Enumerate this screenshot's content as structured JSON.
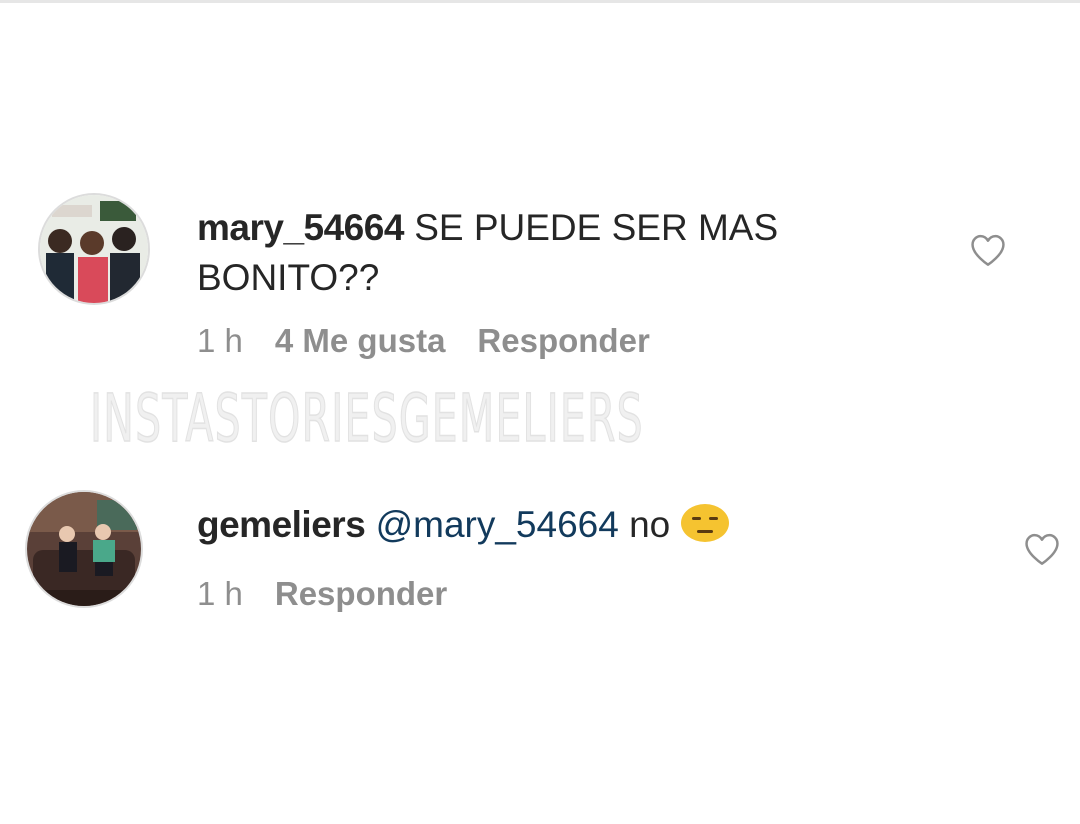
{
  "watermark": "INSTASTORIESGEMELIERS",
  "comments": [
    {
      "username": "mary_54664",
      "text": "SE PUEDE SER MAS BONITO??",
      "time": "1 h",
      "likes": "4 Me gusta",
      "reply_label": "Responder",
      "avatar_icon": "group-photo-avatar",
      "like_icon": "heart-outline-icon"
    },
    {
      "username": "gemeliers",
      "mention": "@mary_54664",
      "text": "no",
      "emoji": "expressionless-face-emoji",
      "time": "1 h",
      "reply_label": "Responder",
      "avatar_icon": "couch-photo-avatar",
      "like_icon": "heart-outline-icon"
    }
  ],
  "colors": {
    "text": "#262626",
    "meta": "#8e8e8e",
    "mention": "#123a5c",
    "background": "#ffffff"
  }
}
